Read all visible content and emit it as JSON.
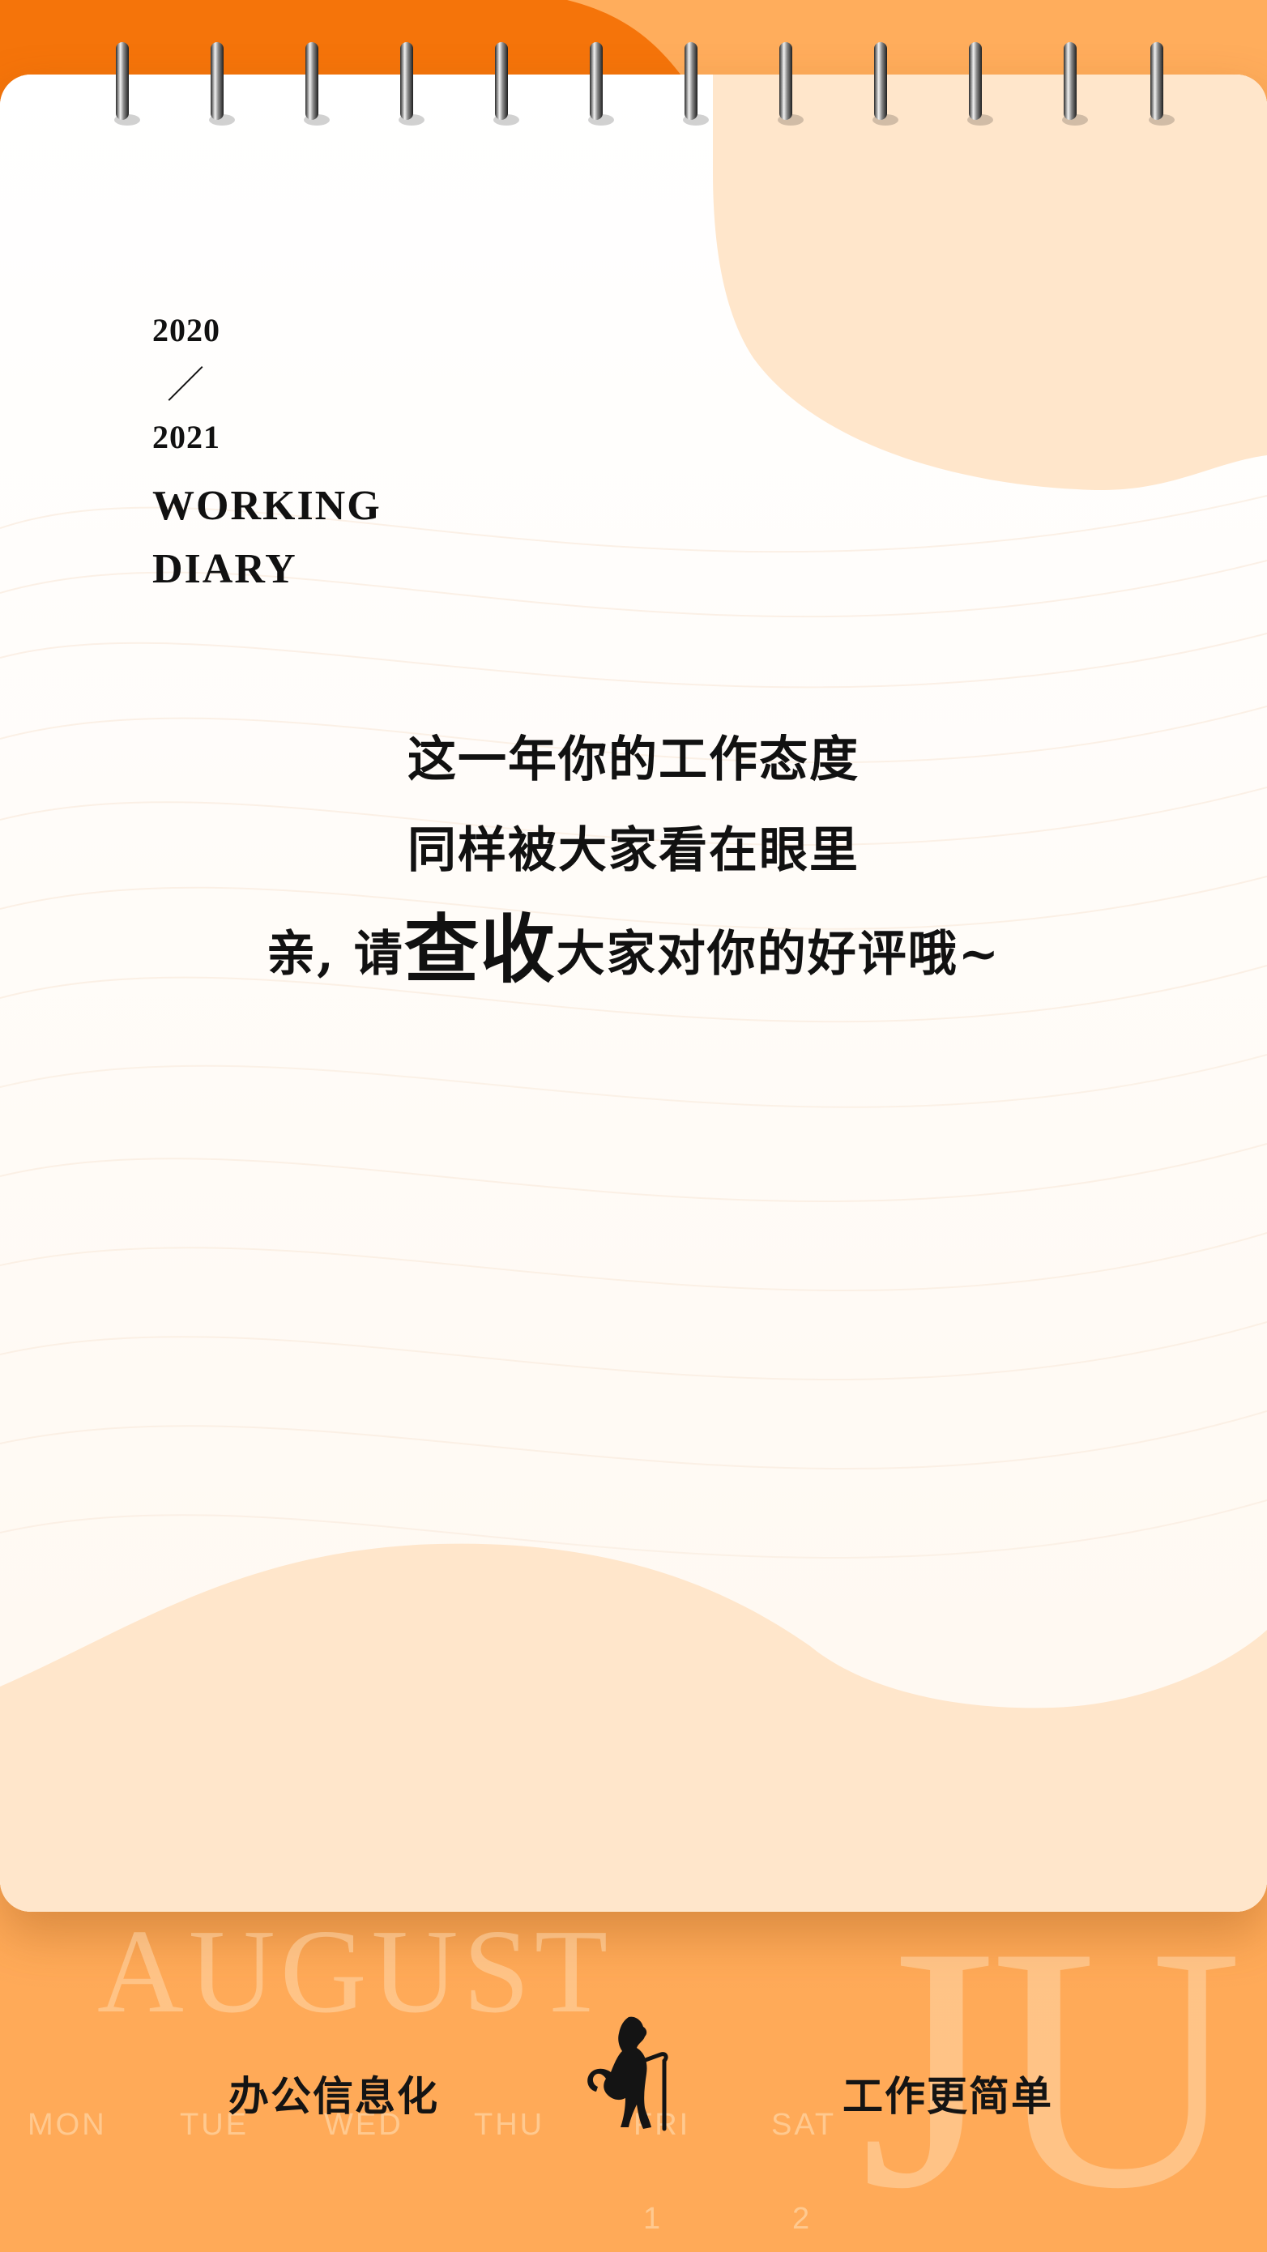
{
  "diary": {
    "year_start": "2020",
    "separator": "／",
    "year_end": "2021",
    "title_line1": "WORKING",
    "title_line2": "DIARY"
  },
  "message": {
    "line1": "这一年你的工作态度",
    "line2": "同样被大家看在眼里",
    "line3_prefix": "亲, 请",
    "line3_emphasis": "查收",
    "line3_suffix": "大家对你的好评哦~"
  },
  "footer": {
    "slogan_left": "办公信息化",
    "slogan_right": "工作更简单",
    "logo_icon": "leopard-with-cane-icon",
    "watermark_month": "AUGUST",
    "watermark_month_partial": "JU",
    "weekdays": [
      "MON",
      "TUE",
      "WED",
      "THU",
      "FRI",
      "SAT"
    ],
    "day_numbers": [
      "1",
      "2"
    ]
  },
  "colors": {
    "primary_orange": "#ffab59",
    "deep_orange": "#f5740a",
    "peach": "#ffe6cb",
    "text": "#111111"
  }
}
